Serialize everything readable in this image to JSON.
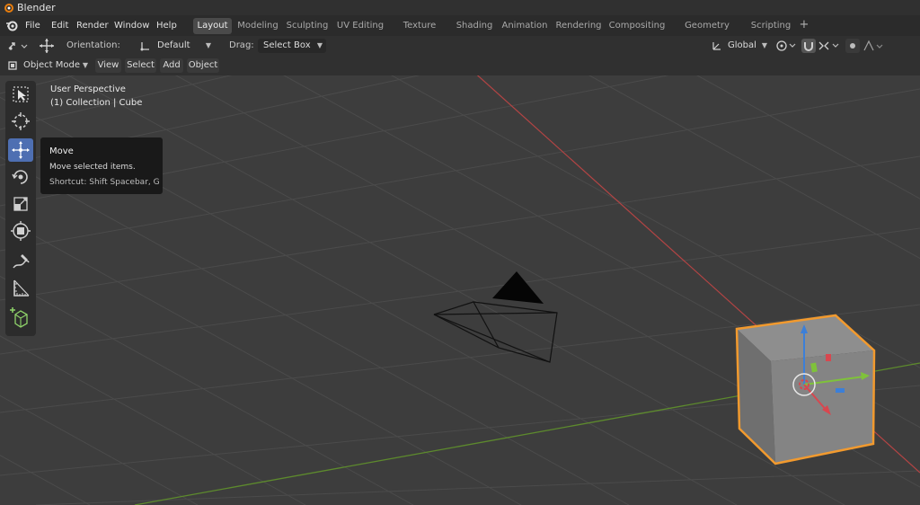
{
  "window": {
    "title": "Blender"
  },
  "menus": [
    "File",
    "Edit",
    "Render",
    "Window",
    "Help"
  ],
  "workspace_tabs": [
    {
      "label": "Layout",
      "active": true
    },
    {
      "label": "Modeling"
    },
    {
      "label": "Sculpting"
    },
    {
      "label": "UV Editing"
    },
    {
      "label": "Texture Paint"
    },
    {
      "label": "Shading"
    },
    {
      "label": "Animation"
    },
    {
      "label": "Rendering"
    },
    {
      "label": "Compositing"
    },
    {
      "label": "Geometry Nodes"
    },
    {
      "label": "Scripting"
    }
  ],
  "tool_header": {
    "orientation_label": "Orientation:",
    "orientation_value": "Default",
    "drag_label": "Drag:",
    "drag_value": "Select Box",
    "transform_space": "Global"
  },
  "viewport_header": {
    "mode": "Object Mode",
    "menus": [
      "View",
      "Select",
      "Add",
      "Object"
    ]
  },
  "overlay": {
    "perspective": "User Perspective",
    "collection": "(1) Collection | Cube"
  },
  "tooltip": {
    "title": "Move",
    "description": "Move selected items.",
    "shortcut": "Shortcut: Shift Spacebar, G"
  },
  "colors": {
    "grid_bg": "#3d3d3d",
    "grid_line": "#4a4a4a",
    "x_axis": "#c44242",
    "y_axis": "#6b9b2f",
    "selection_outline": "#f29a2e",
    "active_tool": "#4e6fb2"
  },
  "tools": [
    {
      "name": "select-box-tool-icon"
    },
    {
      "name": "cursor-tool-icon"
    },
    {
      "name": "move-tool-icon",
      "active": true
    },
    {
      "name": "rotate-tool-icon"
    },
    {
      "name": "scale-tool-icon"
    },
    {
      "name": "transform-tool-icon"
    },
    {
      "name": "annotate-tool-icon"
    },
    {
      "name": "measure-tool-icon"
    },
    {
      "name": "add-cube-tool-icon"
    }
  ]
}
